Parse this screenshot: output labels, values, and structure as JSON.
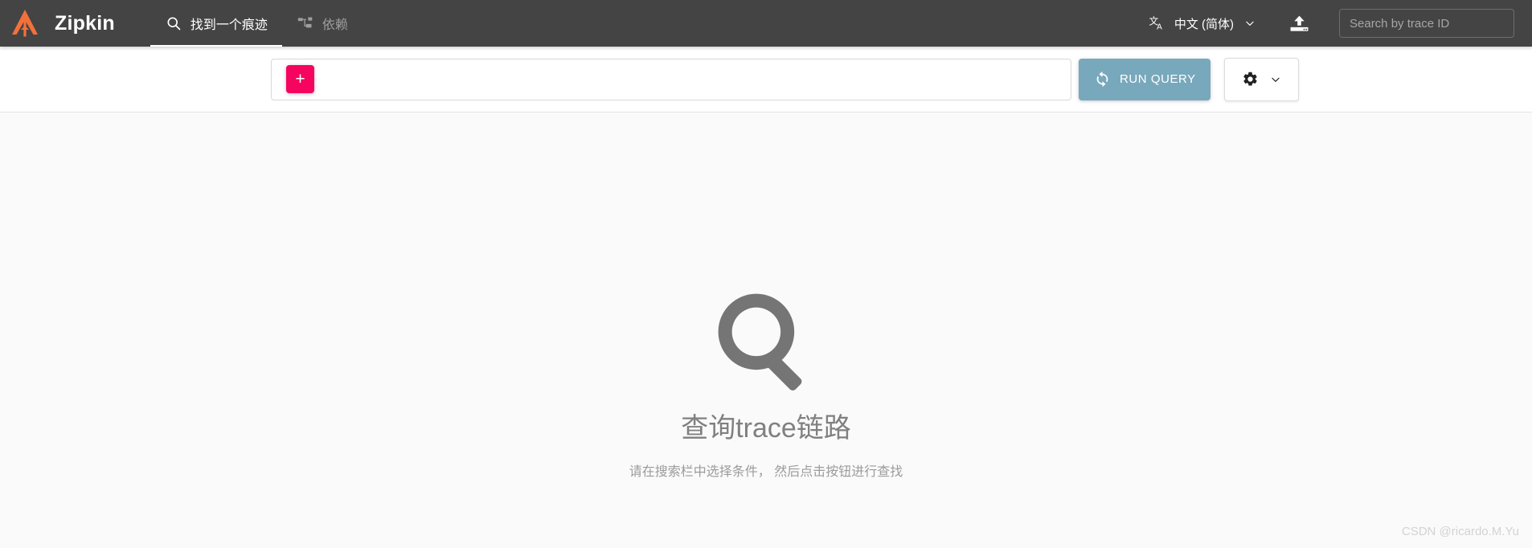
{
  "header": {
    "logo_icon": "zipkin-logo-icon",
    "logo_color": "#f4703a",
    "brand": "Zipkin",
    "background": "#444444",
    "tabs": [
      {
        "id": "find-a-trace",
        "label": "找到一个痕迹",
        "icon": "search-icon",
        "active": true
      },
      {
        "id": "dependencies",
        "label": "依赖",
        "icon": "dependency-tree-icon",
        "active": false
      }
    ],
    "language": {
      "icon": "translate-icon",
      "label": "中文 (简体)",
      "chevron": "chevron-down-icon"
    },
    "upload_icon": "upload-icon",
    "trace_search": {
      "placeholder": "Search by trace ID",
      "value": ""
    }
  },
  "query_bar": {
    "add_criterion_label": "+",
    "add_criterion_color": "#f5055f",
    "add_criterion_icon": "plus-icon",
    "criteria": [],
    "run_query": {
      "label": "RUN QUERY",
      "icon": "sync-refresh-icon",
      "color": "#78a8bb"
    },
    "settings": {
      "icon": "gear-icon",
      "chevron": "chevron-down-icon"
    }
  },
  "empty_state": {
    "icon": "magnifier-icon",
    "icon_color": "#757575",
    "title": "查询trace链路",
    "subtitle": "请在搜索栏中选择条件， 然后点击按钮进行查找"
  },
  "watermark": {
    "text": "CSDN @ricardo.M.Yu"
  }
}
